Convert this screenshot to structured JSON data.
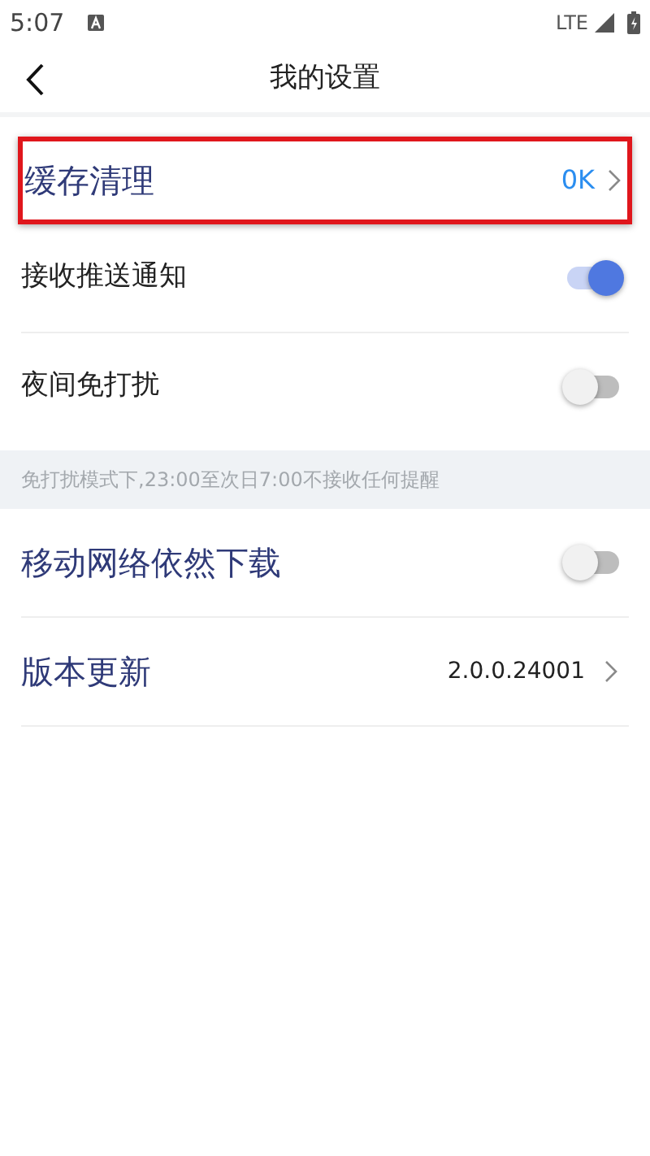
{
  "status_bar": {
    "time": "5:07",
    "network": "LTE"
  },
  "header": {
    "title": "我的设置"
  },
  "rows": [
    {
      "kind": "link",
      "label": "缓存清理",
      "large": true,
      "value": "0K",
      "value_accent": true,
      "highlighted": true,
      "divider": false
    },
    {
      "kind": "toggle",
      "label": "接收推送通知",
      "large": false,
      "on": true,
      "divider": true
    },
    {
      "kind": "toggle",
      "label": "夜间免打扰",
      "large": false,
      "on": false,
      "divider": false
    },
    {
      "kind": "note",
      "label": "免打扰模式下,23:00至次日7:00不接收任何提醒"
    },
    {
      "kind": "toggle",
      "label": "移动网络依然下载",
      "large": true,
      "on": false,
      "divider": true
    },
    {
      "kind": "link",
      "label": "版本更新",
      "large": true,
      "value": "2.0.0.24001",
      "value_accent": false,
      "highlighted": false,
      "divider": true
    }
  ]
}
